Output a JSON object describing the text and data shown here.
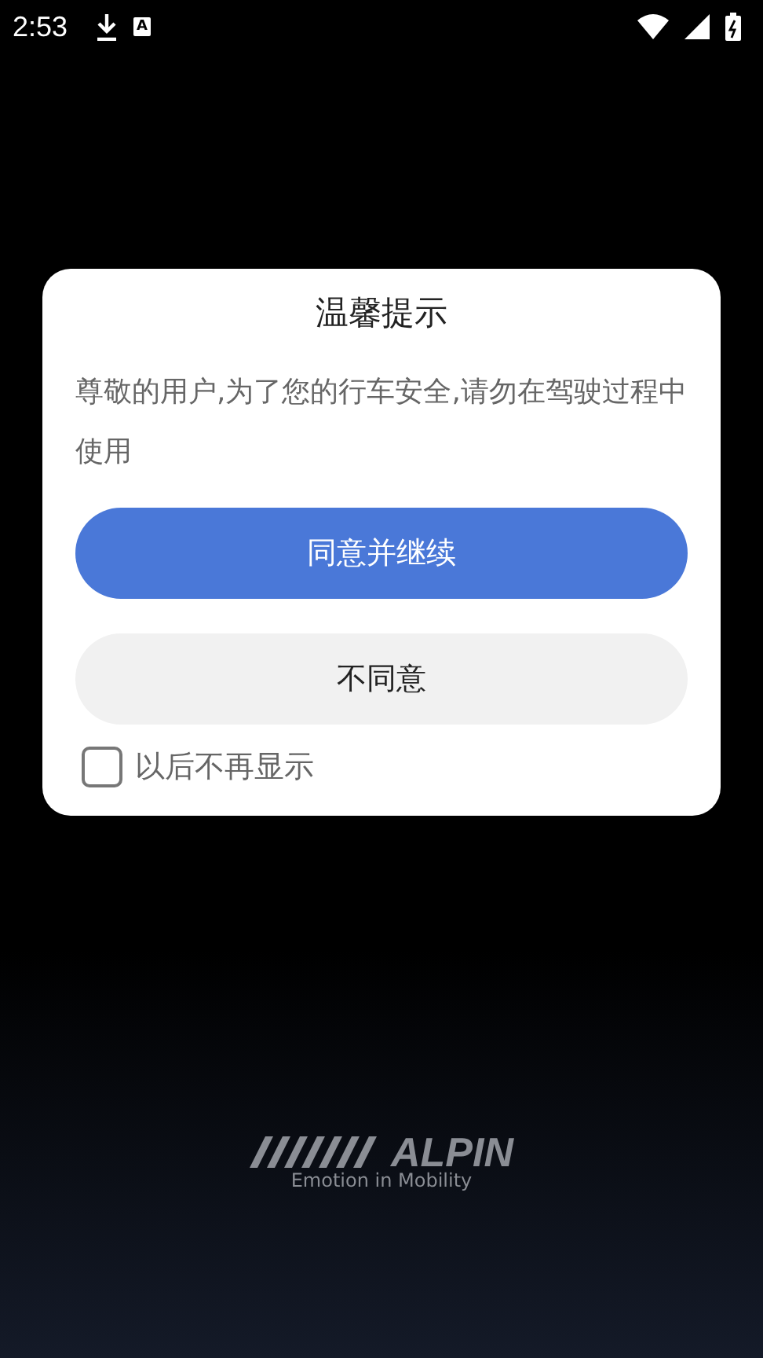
{
  "status_bar": {
    "time": "2:53",
    "notification_letter": "A"
  },
  "dialog": {
    "title": "温馨提示",
    "message": "尊敬的用户,为了您的行车安全,请勿在驾驶过程中使用",
    "buttons": [
      {
        "label": "同意并继续",
        "kind": "primary"
      },
      {
        "label": "不同意",
        "kind": "secondary"
      }
    ],
    "dont_show_again": {
      "label": "以后不再显示",
      "checked": false
    }
  },
  "logo": {
    "wordmark": "ALPIN",
    "tagline": "Emotion in Mobility"
  }
}
